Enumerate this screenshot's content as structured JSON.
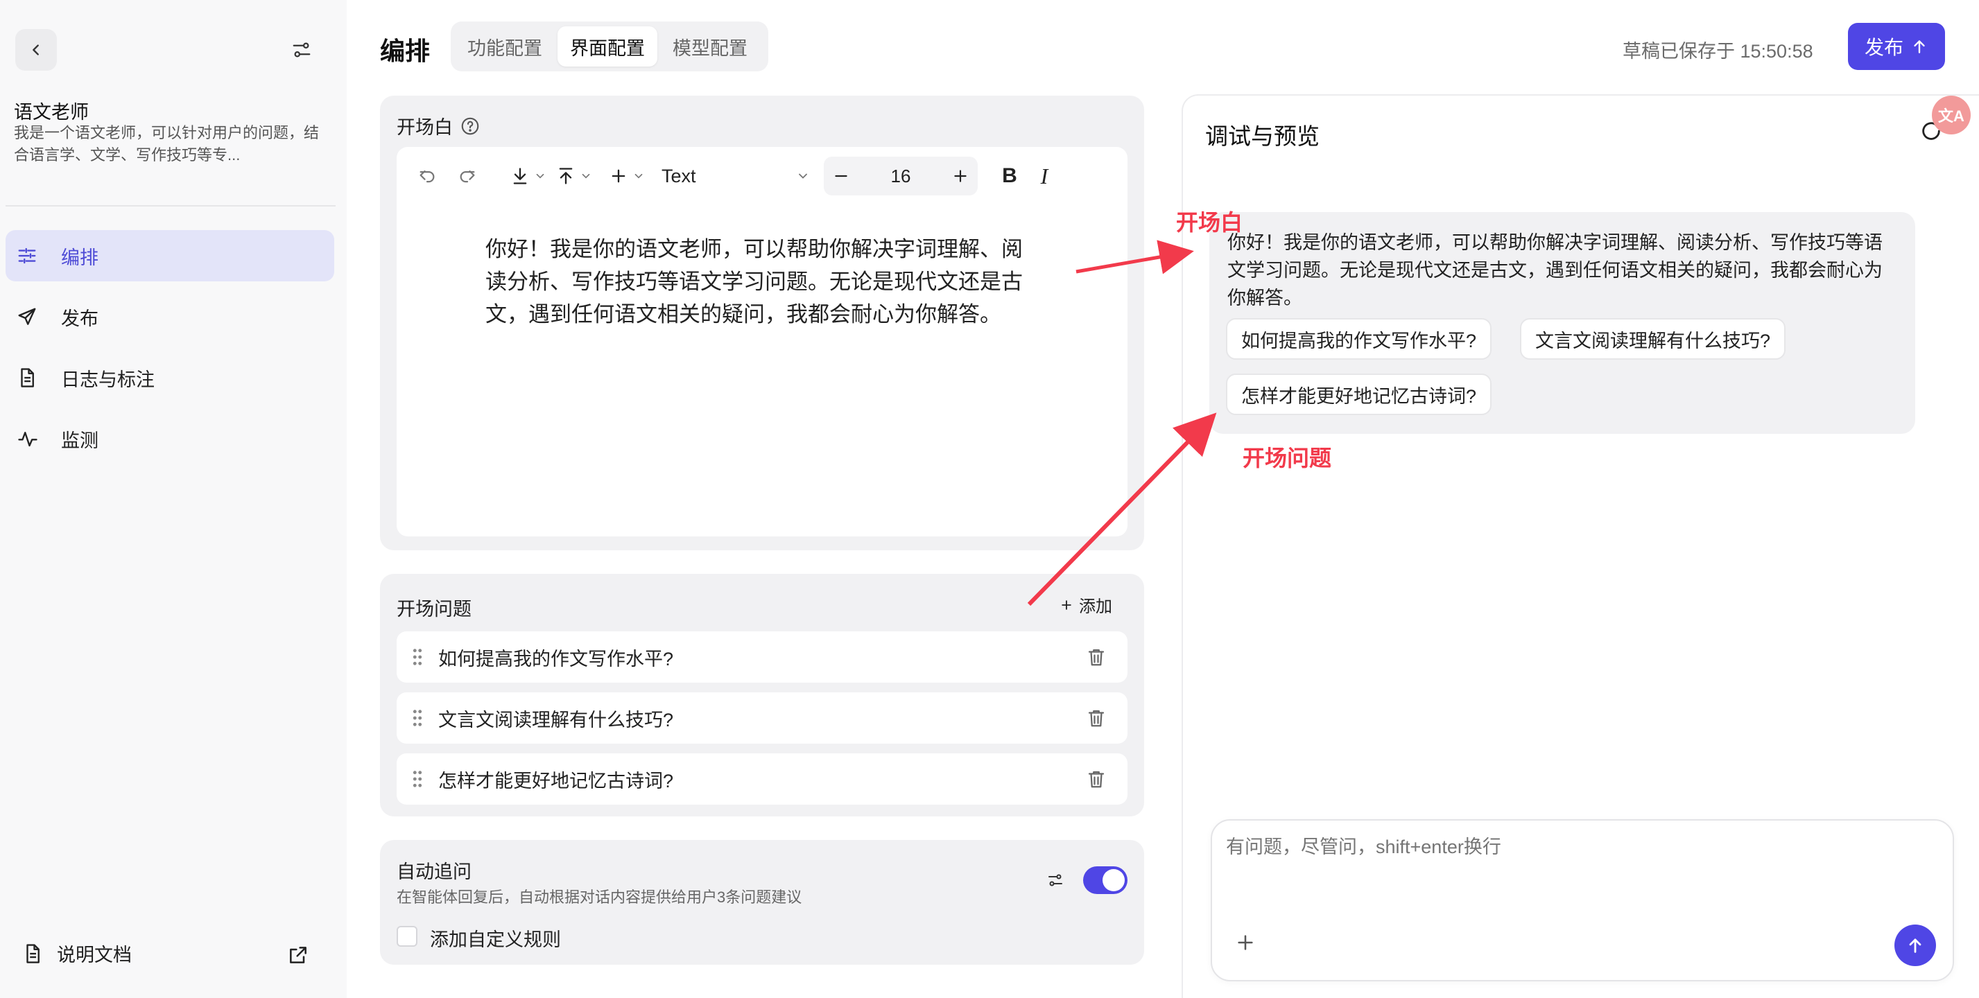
{
  "sidebar": {
    "agent_name": "语文老师",
    "agent_description": "我是一个语文老师，可以针对用户的问题，结合语言学、文学、写作技巧等专...",
    "nav": [
      {
        "label": "编排",
        "icon": "sliders-icon",
        "active": true
      },
      {
        "label": "发布",
        "icon": "send-icon",
        "active": false
      },
      {
        "label": "日志与标注",
        "icon": "document-icon",
        "active": false
      },
      {
        "label": "监测",
        "icon": "pulse-icon",
        "active": false
      }
    ],
    "docs_label": "说明文档"
  },
  "header": {
    "title": "编排",
    "tabs": [
      {
        "label": "功能配置",
        "active": false
      },
      {
        "label": "界面配置",
        "active": true
      },
      {
        "label": "模型配置",
        "active": false
      }
    ],
    "draft_status": "草稿已保存于 15:50:58",
    "publish_label": "发布"
  },
  "opening": {
    "label": "开场白",
    "toolbar": {
      "font_family": "Text",
      "font_size": "16",
      "bold_label": "B",
      "italic_label": "I"
    },
    "text": "你好！我是你的语文老师，可以帮助你解决字词理解、阅读分析、写作技巧等语文学习问题。无论是现代文还是古文，遇到任何语文相关的疑问，我都会耐心为你解答。"
  },
  "questions": {
    "label": "开场问题",
    "add_label": "添加",
    "items": [
      "如何提高我的作文写作水平?",
      "文言文阅读理解有什么技巧?",
      "怎样才能更好地记忆古诗词?"
    ]
  },
  "followup": {
    "title": "自动追问",
    "description": "在智能体回复后，自动根据对话内容提供给用户3条问题建议",
    "enabled": true,
    "custom_rule_label": "添加自定义规则"
  },
  "preview": {
    "title": "调试与预览",
    "translate_badge": "文A",
    "message": "你好！我是你的语文老师，可以帮助你解决字词理解、阅读分析、写作技巧等语文学习问题。无论是现代文还是古文，遇到任何语文相关的疑问，我都会耐心为你解答。",
    "suggestions": [
      "如何提高我的作文写作水平?",
      "文言文阅读理解有什么技巧?",
      "怎样才能更好地记忆古诗词?"
    ],
    "input_placeholder": "有问题，尽管问，shift+enter换行"
  },
  "annotations": {
    "opening": "开场白",
    "questions": "开场问题"
  },
  "colors": {
    "accent": "#4f46e5",
    "annotation": "#f23a4b"
  }
}
